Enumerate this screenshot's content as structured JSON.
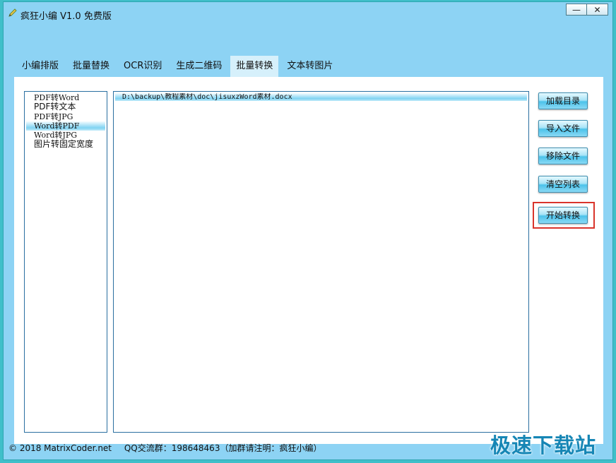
{
  "window": {
    "title": "疯狂小编 V1.0 免费版",
    "minimize_icon": "minimize-icon",
    "close_icon": "close-icon",
    "app_icon": "pencil-icon"
  },
  "tabs": [
    {
      "label": "小编排版"
    },
    {
      "label": "批量替换"
    },
    {
      "label": "OCR识别"
    },
    {
      "label": "生成二维码"
    },
    {
      "label": "批量转换",
      "active": true
    },
    {
      "label": "文本转图片"
    }
  ],
  "file_types": [
    {
      "label": "PDF转Word"
    },
    {
      "label": "PDF转文本"
    },
    {
      "label": "PDF转JPG"
    },
    {
      "label": "Word转PDF",
      "selected": true
    },
    {
      "label": "Word转JPG"
    },
    {
      "label": "图片转固定宽度"
    }
  ],
  "file_list": [
    {
      "path": "D:\\backup\\教程素材\\doc\\jisuxzWord素材.docx"
    }
  ],
  "buttons": {
    "load_dir": "加载目录",
    "import_file": "导入文件",
    "remove_file": "移除文件",
    "clear_list": "清空列表",
    "start_convert": "开始转换"
  },
  "status": {
    "copyright": "© 2018 MatrixCoder.net",
    "qq_group": "QQ交流群：198648463（加群请注明：疯狂小编）"
  },
  "watermark": "极速下载站",
  "colors": {
    "window_bg": "#8dd3f4",
    "highlight_border": "#d9342b",
    "watermark": "#1686b5"
  }
}
